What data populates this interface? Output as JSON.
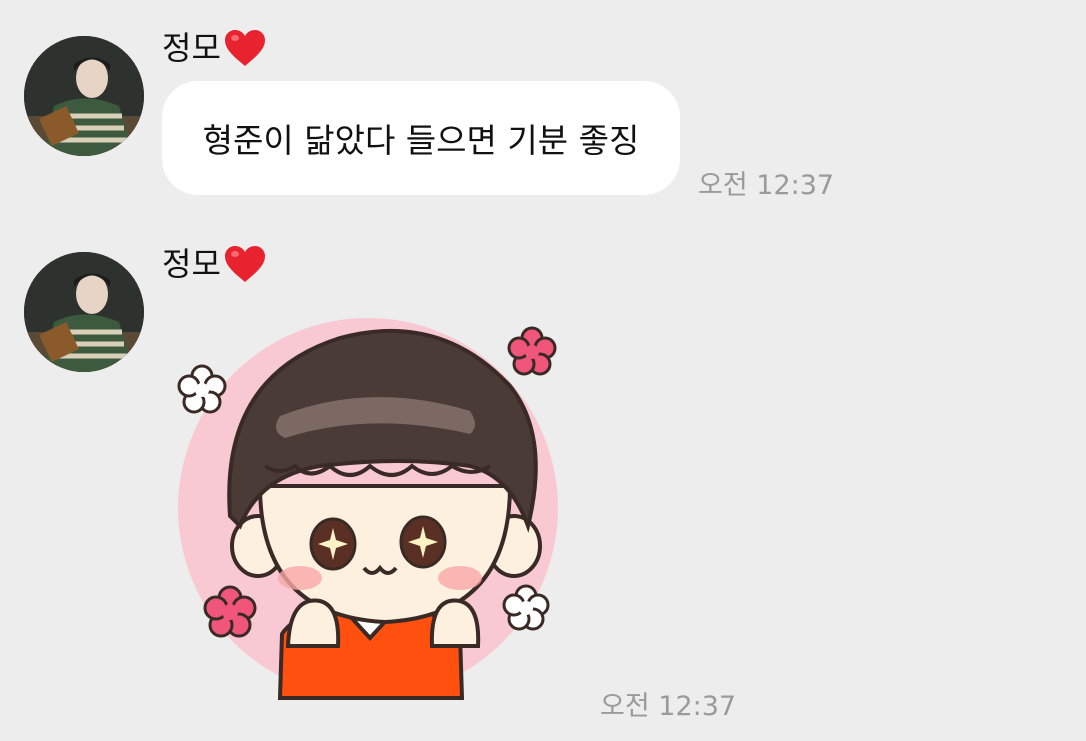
{
  "messages": [
    {
      "sender": "정모",
      "sender_heart_icon": "red-heart-icon",
      "text": "형준이 닮았다 들으면 기분 좋징",
      "time": "오전 12:37"
    },
    {
      "sender": "정모",
      "sender_heart_icon": "red-heart-icon",
      "sticker": "boy-face-sticker",
      "time": "오전 12:37"
    }
  ],
  "colors": {
    "background": "#ededed",
    "bubble": "#ffffff",
    "timestamp": "#9a9a9a",
    "heart": "#e8222e"
  }
}
